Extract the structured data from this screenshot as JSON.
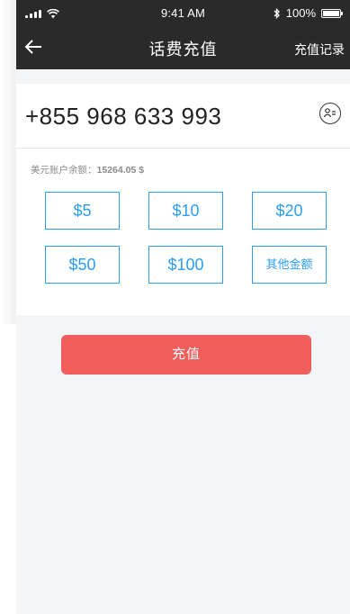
{
  "status_bar": {
    "time": "9:41 AM",
    "battery": "100%"
  },
  "nav": {
    "title": "话费充值",
    "right_link": "充值记录"
  },
  "phone": {
    "number": "+855  968 633 993"
  },
  "balance": {
    "label": "美元账户余额：",
    "amount": "15264.05 $"
  },
  "amounts": [
    {
      "label": "$5"
    },
    {
      "label": "$10"
    },
    {
      "label": "$20"
    },
    {
      "label": "$50"
    },
    {
      "label": "$100"
    },
    {
      "label": "其他金额"
    }
  ],
  "pay_button": {
    "label": "充值"
  },
  "colors": {
    "nav_bg": "#2a2a2a",
    "accent_blue": "#2a9df4",
    "pay_red": "#ef5e5a",
    "page_bg": "#f4f5f7"
  },
  "icons": {
    "back": "arrow-left-icon",
    "contact": "contact-card-icon",
    "signal": "signal-bars-icon",
    "wifi": "wifi-icon",
    "bluetooth": "bluetooth-icon",
    "battery": "battery-icon"
  }
}
